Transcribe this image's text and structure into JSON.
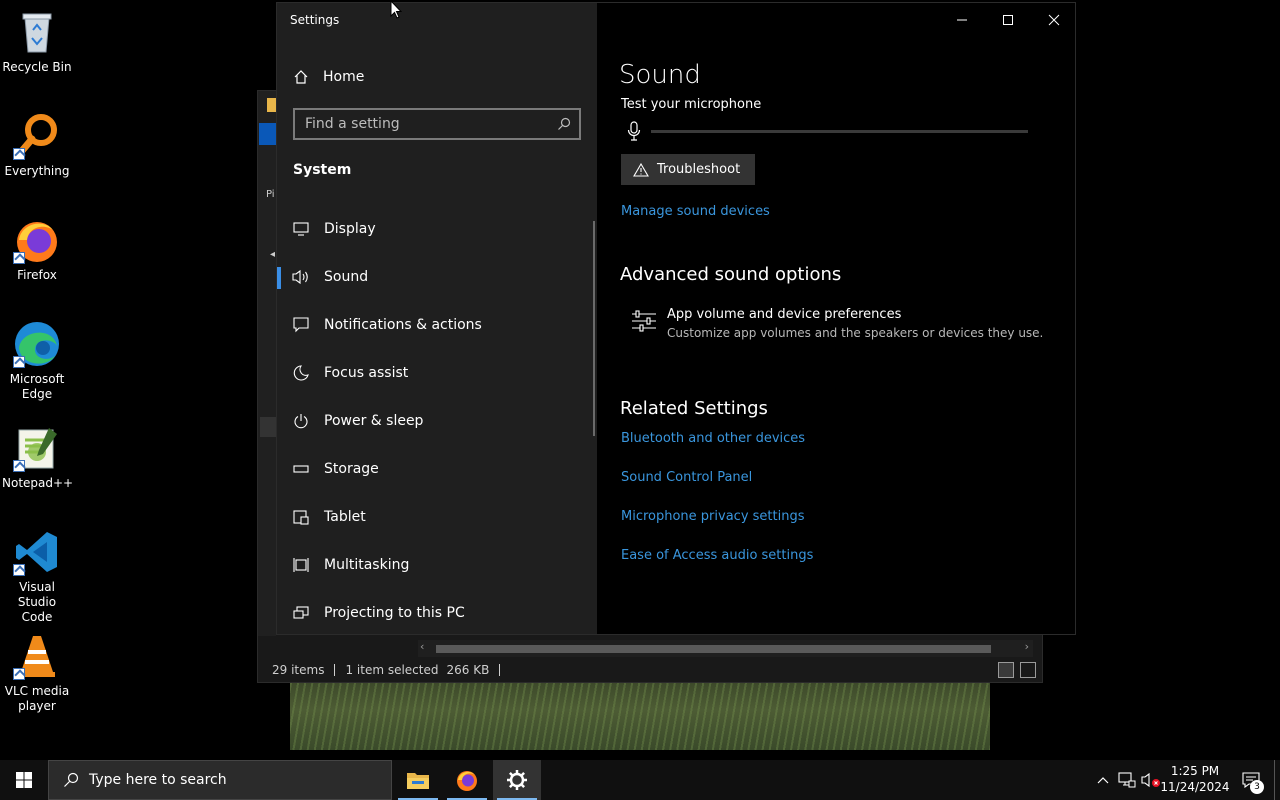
{
  "desktop": {
    "icons": [
      {
        "label": "Recycle Bin"
      },
      {
        "label": "Everything"
      },
      {
        "label": "Firefox"
      },
      {
        "label": "Microsoft Edge"
      },
      {
        "label": "Notepad++"
      },
      {
        "label": "Visual Studio Code"
      },
      {
        "label": "VLC media player"
      }
    ]
  },
  "explorer": {
    "status_items": "29 items",
    "status_selected": "1 item selected",
    "status_size": "266 KB",
    "nav_letter": "Pi"
  },
  "settings": {
    "window_title": "Settings",
    "home_label": "Home",
    "search_placeholder": "Find a setting",
    "section_label": "System",
    "nav": [
      {
        "label": "Display",
        "icon": "display-icon"
      },
      {
        "label": "Sound",
        "icon": "speaker-icon"
      },
      {
        "label": "Notifications & actions",
        "icon": "notification-icon"
      },
      {
        "label": "Focus assist",
        "icon": "moon-icon"
      },
      {
        "label": "Power & sleep",
        "icon": "power-icon"
      },
      {
        "label": "Storage",
        "icon": "storage-icon"
      },
      {
        "label": "Tablet",
        "icon": "tablet-icon"
      },
      {
        "label": "Multitasking",
        "icon": "multitasking-icon"
      },
      {
        "label": "Projecting to this PC",
        "icon": "projecting-icon"
      }
    ],
    "active_nav": "Sound",
    "page_title": "Sound",
    "test_mic_label": "Test your microphone",
    "troubleshoot_label": "Troubleshoot",
    "manage_devices_link": "Manage sound devices",
    "advanced_heading": "Advanced sound options",
    "app_volume_title": "App volume and device preferences",
    "app_volume_desc": "Customize app volumes and the speakers or devices they use.",
    "related_heading": "Related Settings",
    "related_links": [
      "Bluetooth and other devices",
      "Sound Control Panel",
      "Microphone privacy settings",
      "Ease of Access audio settings"
    ],
    "accent_color": "#3a96dd"
  },
  "taskbar": {
    "search_placeholder": "Type here to search",
    "time": "1:25 PM",
    "date": "11/24/2024",
    "notification_count": "3"
  }
}
